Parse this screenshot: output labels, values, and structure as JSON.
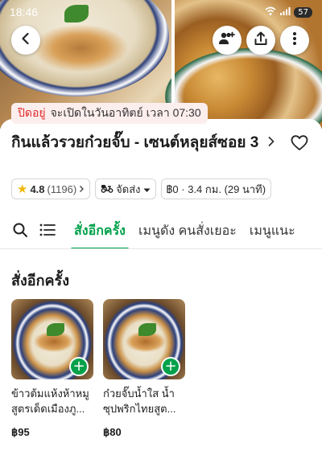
{
  "status_bar": {
    "time": "18:46",
    "battery": "57"
  },
  "store": {
    "status_closed": "ปิดอยู่",
    "status_opens": "จะเปิดในวันอาทิตย์ เวลา 07:30",
    "name": "กินแล้วรวยก๋วยจั๊บ - เซนต์หลุยส์ซอย 3"
  },
  "info_chips": {
    "rating": "4.8",
    "rating_count": "(1196)",
    "delivery_label": "จัดส่ง",
    "delivery_details": "฿0 · 3.4 กม. (29 นาที)"
  },
  "tabs": [
    {
      "label": "สั่งอีกครั้ง",
      "active": true
    },
    {
      "label": "เมนูดัง คนสั่งเยอะ",
      "active": false
    },
    {
      "label": "เมนูแนะ",
      "active": false
    }
  ],
  "section": {
    "title": "สั่งอีกครั้ง"
  },
  "items": [
    {
      "name": "ข้าวต้มแห้งห้าหมู สูตรเด็ดเมืองภู...",
      "price": "฿95"
    },
    {
      "name": "ก๋วยจั๊บน้ำใส น้ำซุปพริกไทยสูต...",
      "price": "฿80"
    }
  ],
  "icons": {
    "back": "back-arrow-icon",
    "group_order": "add-people-icon",
    "share": "share-icon",
    "more": "more-vertical-icon",
    "favorite": "heart-icon",
    "search": "search-icon",
    "menu_list": "list-icon",
    "add": "plus-icon"
  },
  "colors": {
    "brand_green": "#00a14b",
    "closed_red": "#e02a2a",
    "star": "#f2b705"
  }
}
